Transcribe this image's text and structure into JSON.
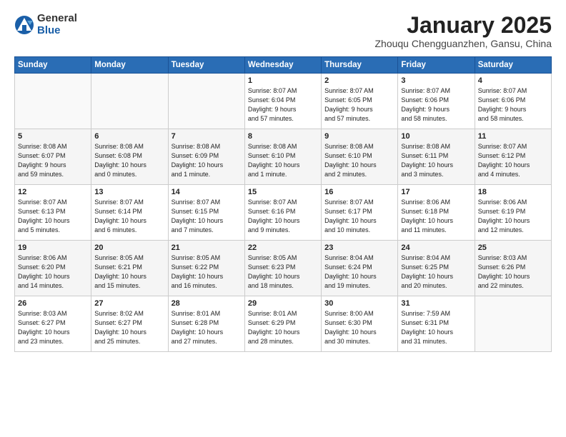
{
  "logo": {
    "general": "General",
    "blue": "Blue"
  },
  "title": "January 2025",
  "subtitle": "Zhouqu Chengguanzhen, Gansu, China",
  "days_of_week": [
    "Sunday",
    "Monday",
    "Tuesday",
    "Wednesday",
    "Thursday",
    "Friday",
    "Saturday"
  ],
  "weeks": [
    [
      {
        "day": "",
        "info": ""
      },
      {
        "day": "",
        "info": ""
      },
      {
        "day": "",
        "info": ""
      },
      {
        "day": "1",
        "info": "Sunrise: 8:07 AM\nSunset: 6:04 PM\nDaylight: 9 hours\nand 57 minutes."
      },
      {
        "day": "2",
        "info": "Sunrise: 8:07 AM\nSunset: 6:05 PM\nDaylight: 9 hours\nand 57 minutes."
      },
      {
        "day": "3",
        "info": "Sunrise: 8:07 AM\nSunset: 6:06 PM\nDaylight: 9 hours\nand 58 minutes."
      },
      {
        "day": "4",
        "info": "Sunrise: 8:07 AM\nSunset: 6:06 PM\nDaylight: 9 hours\nand 58 minutes."
      }
    ],
    [
      {
        "day": "5",
        "info": "Sunrise: 8:08 AM\nSunset: 6:07 PM\nDaylight: 9 hours\nand 59 minutes."
      },
      {
        "day": "6",
        "info": "Sunrise: 8:08 AM\nSunset: 6:08 PM\nDaylight: 10 hours\nand 0 minutes."
      },
      {
        "day": "7",
        "info": "Sunrise: 8:08 AM\nSunset: 6:09 PM\nDaylight: 10 hours\nand 1 minute."
      },
      {
        "day": "8",
        "info": "Sunrise: 8:08 AM\nSunset: 6:10 PM\nDaylight: 10 hours\nand 1 minute."
      },
      {
        "day": "9",
        "info": "Sunrise: 8:08 AM\nSunset: 6:10 PM\nDaylight: 10 hours\nand 2 minutes."
      },
      {
        "day": "10",
        "info": "Sunrise: 8:08 AM\nSunset: 6:11 PM\nDaylight: 10 hours\nand 3 minutes."
      },
      {
        "day": "11",
        "info": "Sunrise: 8:07 AM\nSunset: 6:12 PM\nDaylight: 10 hours\nand 4 minutes."
      }
    ],
    [
      {
        "day": "12",
        "info": "Sunrise: 8:07 AM\nSunset: 6:13 PM\nDaylight: 10 hours\nand 5 minutes."
      },
      {
        "day": "13",
        "info": "Sunrise: 8:07 AM\nSunset: 6:14 PM\nDaylight: 10 hours\nand 6 minutes."
      },
      {
        "day": "14",
        "info": "Sunrise: 8:07 AM\nSunset: 6:15 PM\nDaylight: 10 hours\nand 7 minutes."
      },
      {
        "day": "15",
        "info": "Sunrise: 8:07 AM\nSunset: 6:16 PM\nDaylight: 10 hours\nand 9 minutes."
      },
      {
        "day": "16",
        "info": "Sunrise: 8:07 AM\nSunset: 6:17 PM\nDaylight: 10 hours\nand 10 minutes."
      },
      {
        "day": "17",
        "info": "Sunrise: 8:06 AM\nSunset: 6:18 PM\nDaylight: 10 hours\nand 11 minutes."
      },
      {
        "day": "18",
        "info": "Sunrise: 8:06 AM\nSunset: 6:19 PM\nDaylight: 10 hours\nand 12 minutes."
      }
    ],
    [
      {
        "day": "19",
        "info": "Sunrise: 8:06 AM\nSunset: 6:20 PM\nDaylight: 10 hours\nand 14 minutes."
      },
      {
        "day": "20",
        "info": "Sunrise: 8:05 AM\nSunset: 6:21 PM\nDaylight: 10 hours\nand 15 minutes."
      },
      {
        "day": "21",
        "info": "Sunrise: 8:05 AM\nSunset: 6:22 PM\nDaylight: 10 hours\nand 16 minutes."
      },
      {
        "day": "22",
        "info": "Sunrise: 8:05 AM\nSunset: 6:23 PM\nDaylight: 10 hours\nand 18 minutes."
      },
      {
        "day": "23",
        "info": "Sunrise: 8:04 AM\nSunset: 6:24 PM\nDaylight: 10 hours\nand 19 minutes."
      },
      {
        "day": "24",
        "info": "Sunrise: 8:04 AM\nSunset: 6:25 PM\nDaylight: 10 hours\nand 20 minutes."
      },
      {
        "day": "25",
        "info": "Sunrise: 8:03 AM\nSunset: 6:26 PM\nDaylight: 10 hours\nand 22 minutes."
      }
    ],
    [
      {
        "day": "26",
        "info": "Sunrise: 8:03 AM\nSunset: 6:27 PM\nDaylight: 10 hours\nand 23 minutes."
      },
      {
        "day": "27",
        "info": "Sunrise: 8:02 AM\nSunset: 6:27 PM\nDaylight: 10 hours\nand 25 minutes."
      },
      {
        "day": "28",
        "info": "Sunrise: 8:01 AM\nSunset: 6:28 PM\nDaylight: 10 hours\nand 27 minutes."
      },
      {
        "day": "29",
        "info": "Sunrise: 8:01 AM\nSunset: 6:29 PM\nDaylight: 10 hours\nand 28 minutes."
      },
      {
        "day": "30",
        "info": "Sunrise: 8:00 AM\nSunset: 6:30 PM\nDaylight: 10 hours\nand 30 minutes."
      },
      {
        "day": "31",
        "info": "Sunrise: 7:59 AM\nSunset: 6:31 PM\nDaylight: 10 hours\nand 31 minutes."
      },
      {
        "day": "",
        "info": ""
      }
    ]
  ]
}
